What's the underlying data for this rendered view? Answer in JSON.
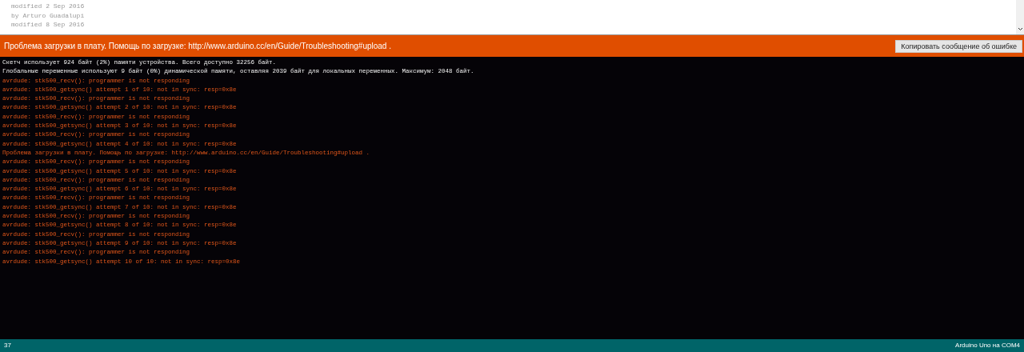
{
  "editor": {
    "lines": [
      "modified 2 Sep 2016",
      "by Arturo Guadalupi",
      "modified 8 Sep 2016"
    ]
  },
  "error_bar": {
    "message": "Проблема загрузки в плату. Помощь по загрузке: http://www.arduino.cc/en/Guide/Troubleshooting#upload .",
    "copy_button": "Копировать сообщение об ошибке"
  },
  "console": [
    {
      "kind": "info",
      "text": "Скетч использует 924 байт (2%) памяти устройства. Всего доступно 32256 байт."
    },
    {
      "kind": "info",
      "text": "Глобальные переменные используют 9 байт (0%) динамической памяти, оставляя 2039 байт для локальных переменных. Максимум: 2048 байт."
    },
    {
      "kind": "error",
      "text": "avrdude: stk500_recv(): programmer is not responding"
    },
    {
      "kind": "error",
      "text": "avrdude: stk500_getsync() attempt 1 of 10: not in sync: resp=0x8e"
    },
    {
      "kind": "error",
      "text": "avrdude: stk500_recv(): programmer is not responding"
    },
    {
      "kind": "error",
      "text": "avrdude: stk500_getsync() attempt 2 of 10: not in sync: resp=0x8e"
    },
    {
      "kind": "error",
      "text": "avrdude: stk500_recv(): programmer is not responding"
    },
    {
      "kind": "error",
      "text": "avrdude: stk500_getsync() attempt 3 of 10: not in sync: resp=0x8e"
    },
    {
      "kind": "error",
      "text": "avrdude: stk500_recv(): programmer is not responding"
    },
    {
      "kind": "error",
      "text": "avrdude: stk500_getsync() attempt 4 of 10: not in sync: resp=0x8e"
    },
    {
      "kind": "error",
      "text": "Проблема загрузки в плату. Помощь по загрузке: http://www.arduino.cc/en/Guide/Troubleshooting#upload ."
    },
    {
      "kind": "error",
      "text": "avrdude: stk500_recv(): programmer is not responding"
    },
    {
      "kind": "error",
      "text": "avrdude: stk500_getsync() attempt 5 of 10: not in sync: resp=0x8e"
    },
    {
      "kind": "error",
      "text": "avrdude: stk500_recv(): programmer is not responding"
    },
    {
      "kind": "error",
      "text": "avrdude: stk500_getsync() attempt 6 of 10: not in sync: resp=0x8e"
    },
    {
      "kind": "error",
      "text": "avrdude: stk500_recv(): programmer is not responding"
    },
    {
      "kind": "error",
      "text": "avrdude: stk500_getsync() attempt 7 of 10: not in sync: resp=0x8e"
    },
    {
      "kind": "error",
      "text": "avrdude: stk500_recv(): programmer is not responding"
    },
    {
      "kind": "error",
      "text": "avrdude: stk500_getsync() attempt 8 of 10: not in sync: resp=0x8e"
    },
    {
      "kind": "error",
      "text": "avrdude: stk500_recv(): programmer is not responding"
    },
    {
      "kind": "error",
      "text": "avrdude: stk500_getsync() attempt 9 of 10: not in sync: resp=0x8e"
    },
    {
      "kind": "error",
      "text": "avrdude: stk500_recv(): programmer is not responding"
    },
    {
      "kind": "error",
      "text": "avrdude: stk500_getsync() attempt 10 of 10: not in sync: resp=0x8e"
    }
  ],
  "status_bar": {
    "line": "37",
    "board": "Arduino Uno на COM4"
  }
}
